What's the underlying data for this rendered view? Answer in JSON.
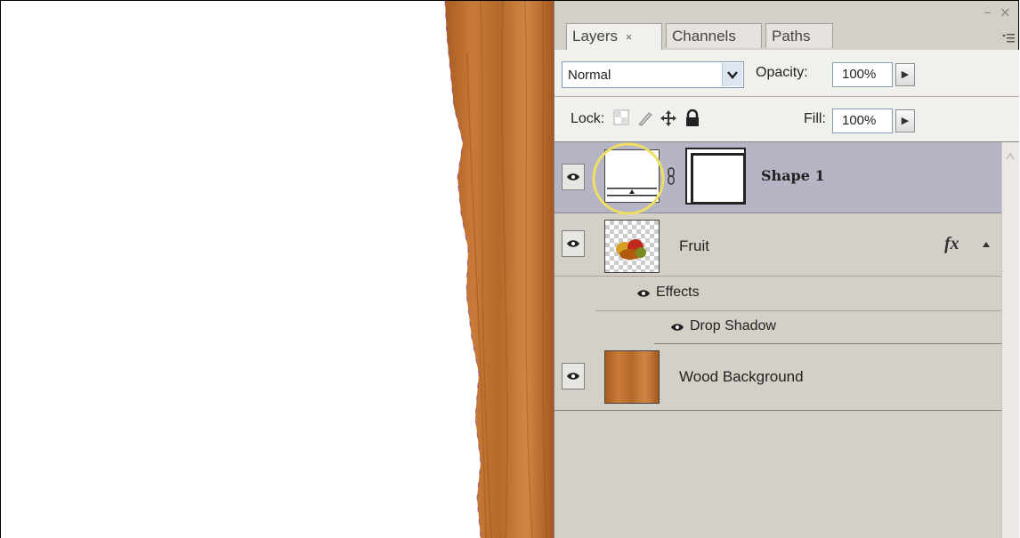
{
  "panel": {
    "tabs": [
      {
        "label": "Layers",
        "close": "×"
      },
      {
        "label": "Channels"
      },
      {
        "label": "Paths"
      }
    ],
    "window_controls": "– ×",
    "blend_mode": "Normal",
    "opacity_label": "Opacity:",
    "opacity_value": "100%",
    "lock_label": "Lock:",
    "fill_label": "Fill:",
    "fill_value": "100%",
    "step_arrow": "▶",
    "fx_label": "fx"
  },
  "layers": [
    {
      "name": "Shape 1",
      "selected": true,
      "icon": "shape-layer-thumbnail"
    },
    {
      "name": "Fruit",
      "has_effects": true,
      "icon": "fruit-thumbnail"
    },
    {
      "name": "Effects",
      "sub": true
    },
    {
      "name": "Drop Shadow",
      "sub": true
    },
    {
      "name": "Wood Background",
      "icon": "wood-thumbnail"
    }
  ],
  "colors": {
    "panel_bg": "#d4d0c8",
    "selected_row": "#b5b5c6",
    "highlight_circle": "#f0e060",
    "wood": "#b86a2a"
  }
}
